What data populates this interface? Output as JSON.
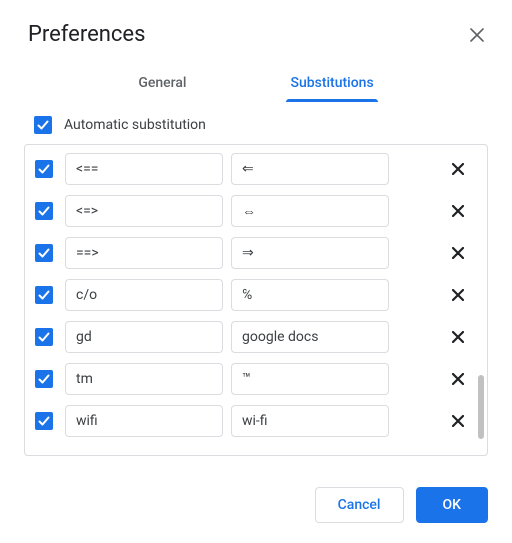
{
  "title": "Preferences",
  "tabs": {
    "general": "General",
    "substitutions": "Substitutions"
  },
  "auto_sub_label": "Automatic substitution",
  "rows": [
    {
      "replace": "<==",
      "with": "⇐"
    },
    {
      "replace": "<=>",
      "with": "⇔"
    },
    {
      "replace": "==>",
      "with": "⇒"
    },
    {
      "replace": "c/o",
      "with": "℅"
    },
    {
      "replace": "gd",
      "with": "google docs"
    },
    {
      "replace": "tm",
      "with": "™"
    },
    {
      "replace": "wifi",
      "with": "wi-fi"
    }
  ],
  "buttons": {
    "cancel": "Cancel",
    "ok": "OK"
  }
}
